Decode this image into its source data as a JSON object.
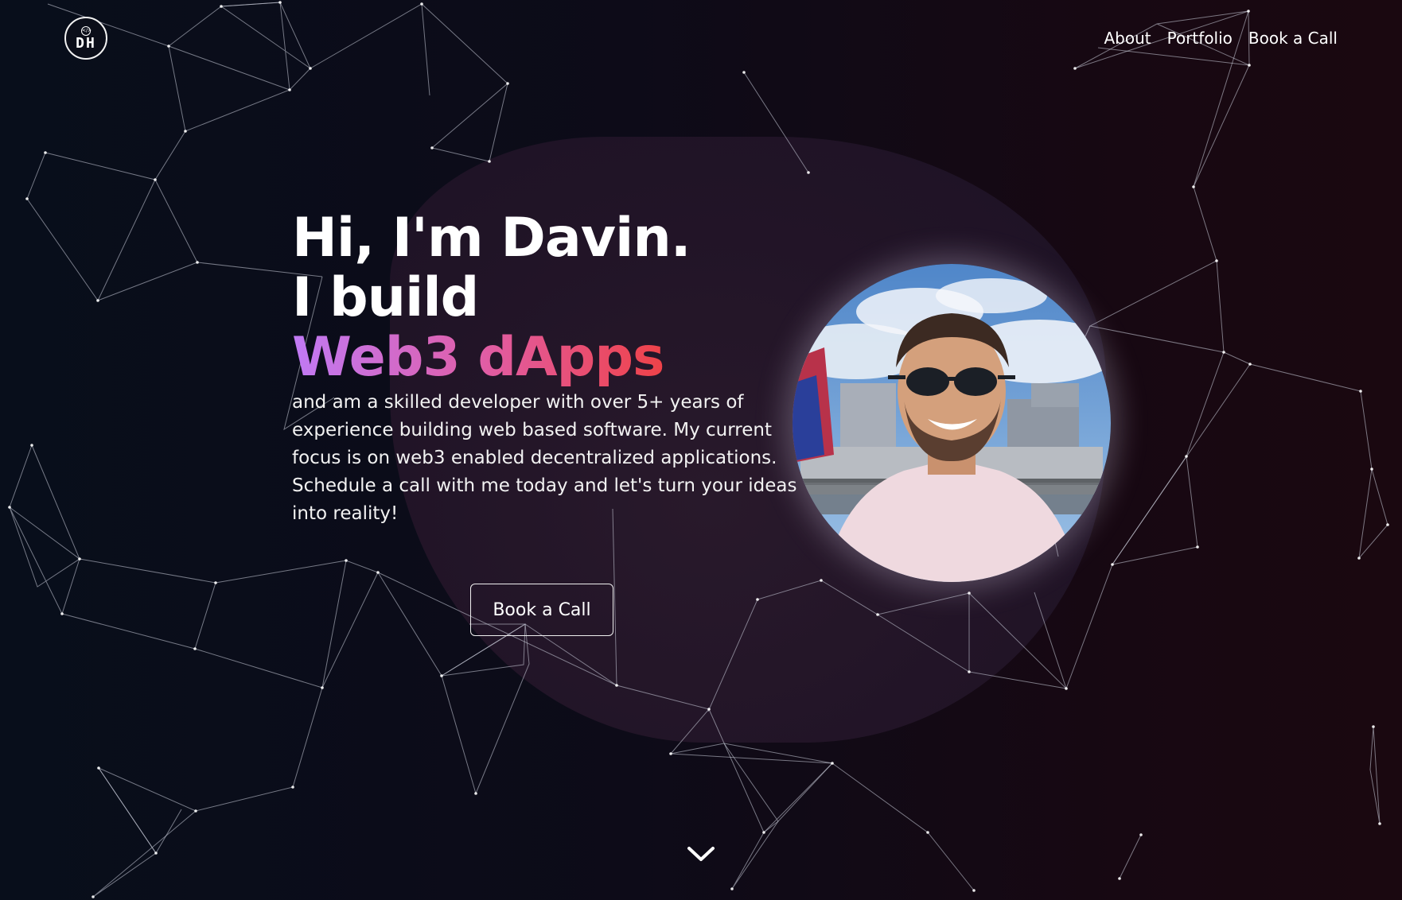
{
  "logo": {
    "monogram": "DH",
    "glyph": "</>"
  },
  "nav": {
    "items": [
      {
        "label": "About"
      },
      {
        "label": "Portfolio"
      },
      {
        "label": "Book a Call"
      }
    ]
  },
  "hero": {
    "greeting": "Hi, I'm Davin.",
    "line2": "I build",
    "highlight": "Web3 dApps",
    "description": "and am a skilled developer with over 5+ years of experience building web based software. My current focus is on web3 enabled decentralized applications. Schedule a call with me today and let's turn your ideas into reality!",
    "cta_label": "Book a Call"
  },
  "profile_photo": {
    "icon": "profile-photo"
  },
  "scroll": {
    "icon": "chevron-down-icon"
  },
  "colors": {
    "background": "#0a0d18",
    "accent_start": "#c07af5",
    "accent_mid": "#e05ea8",
    "accent_end": "#ef4248",
    "text": "#ffffff"
  }
}
